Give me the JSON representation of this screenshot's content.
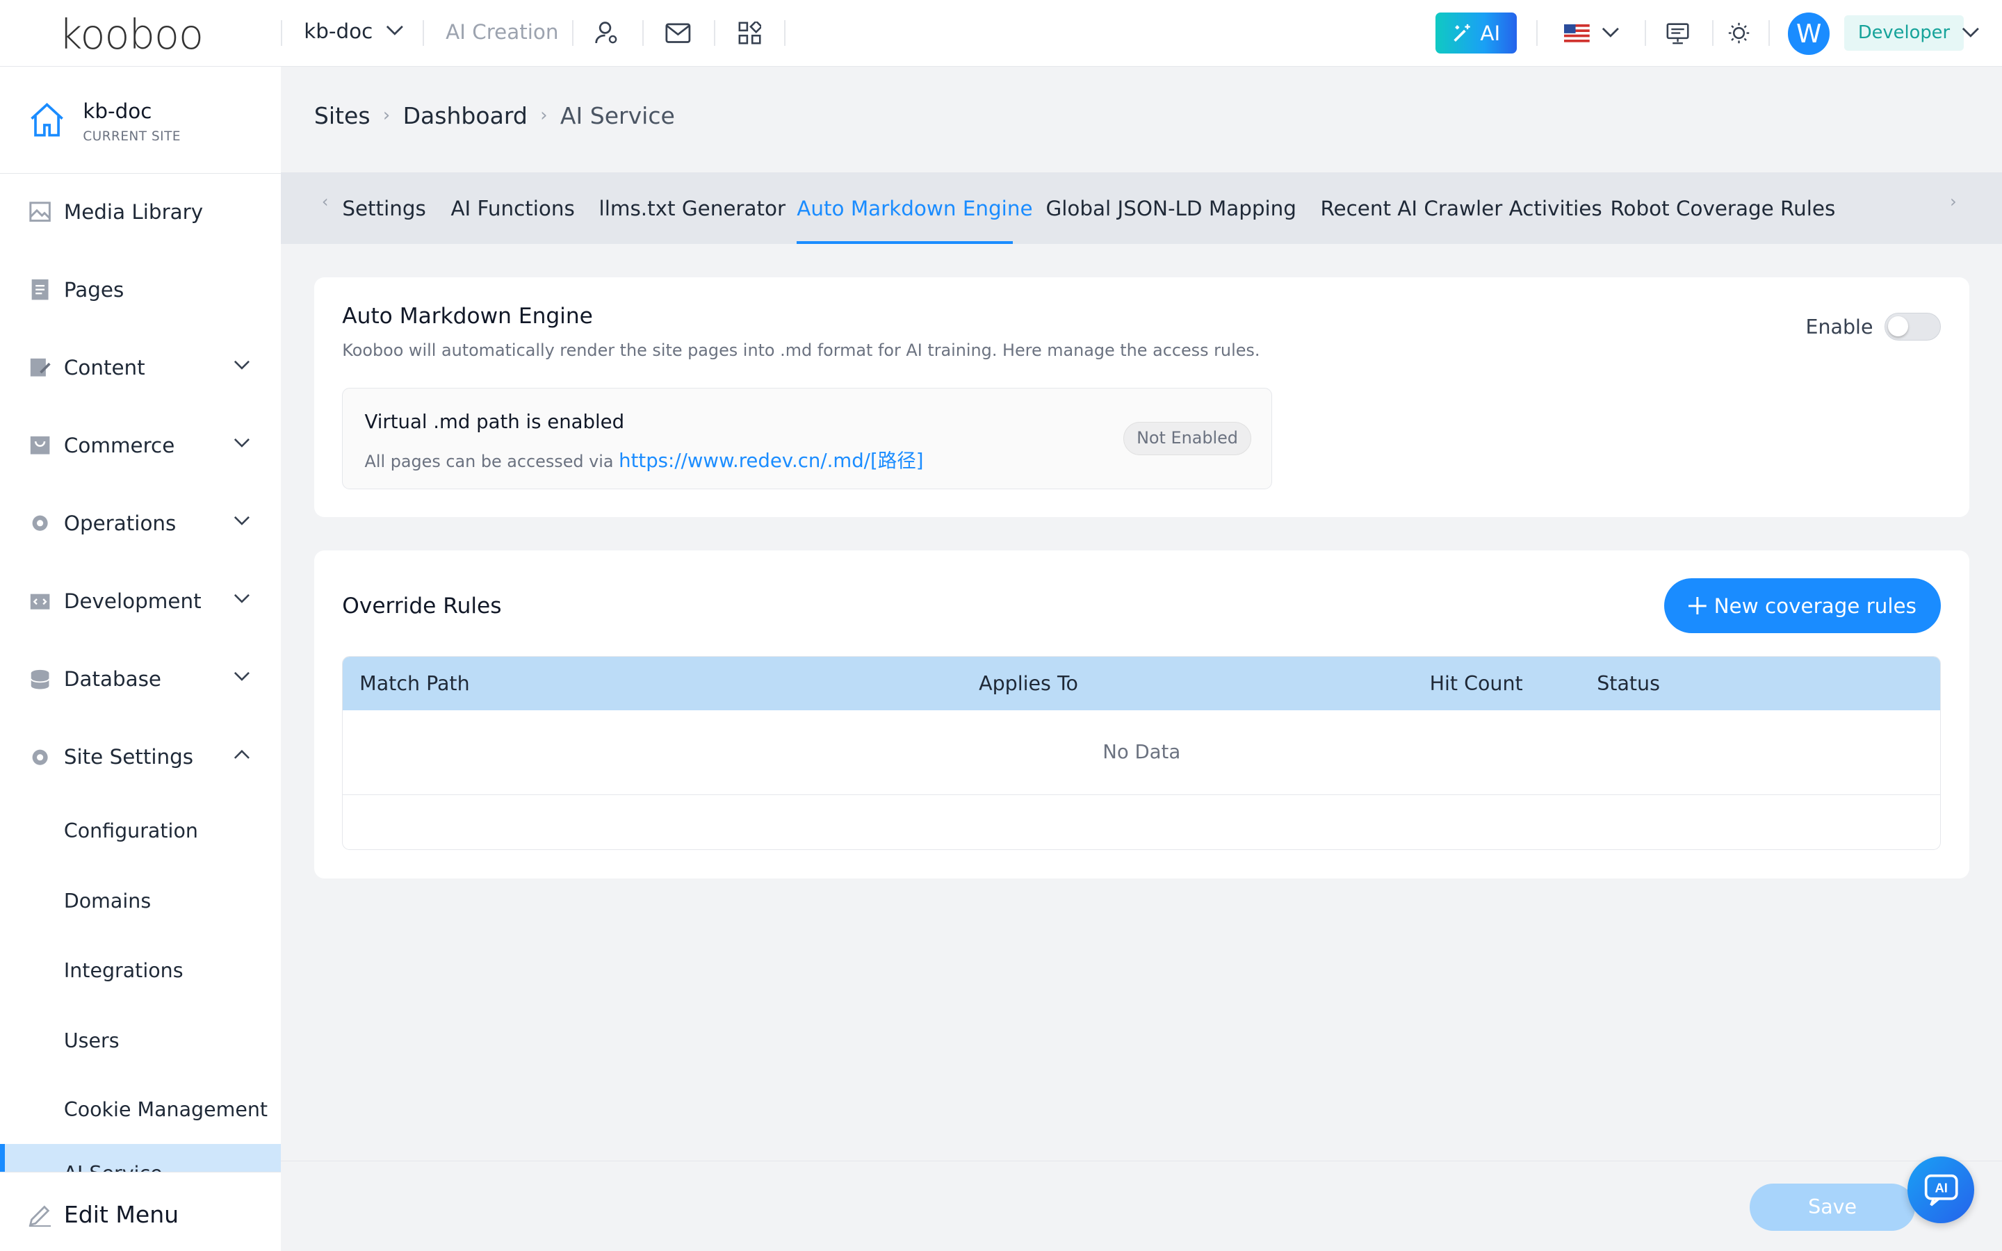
{
  "app": {
    "logo_text": "kooboo"
  },
  "topbar": {
    "site_name": "kb-doc",
    "ai_creation_label": "AI Creation",
    "ai_button_label": "AI",
    "avatar_initial": "W",
    "role_label": "Developer",
    "accent_color": "#1a8cff"
  },
  "sidebar": {
    "site_name": "kb-doc",
    "site_sub": "CURRENT SITE",
    "items": [
      {
        "label": "Media Library"
      },
      {
        "label": "Pages"
      },
      {
        "label": "Content"
      },
      {
        "label": "Commerce"
      },
      {
        "label": "Operations"
      },
      {
        "label": "Development"
      },
      {
        "label": "Database"
      },
      {
        "label": "Site Settings"
      }
    ],
    "sub_items": [
      {
        "label": "Configuration"
      },
      {
        "label": "Domains"
      },
      {
        "label": "Integrations"
      },
      {
        "label": "Users"
      },
      {
        "label": "Cookie Management"
      },
      {
        "label": "AI Service"
      }
    ],
    "edit_menu_label": "Edit Menu"
  },
  "breadcrumb": [
    "Sites",
    "Dashboard",
    "AI Service"
  ],
  "tabs": [
    {
      "label": "Settings"
    },
    {
      "label": "AI Functions"
    },
    {
      "label": "llms.txt Generator"
    },
    {
      "label": "Auto Markdown Engine"
    },
    {
      "label": "Global JSON-LD Mapping"
    },
    {
      "label": "Recent AI Crawler Activities"
    },
    {
      "label": "Robot Coverage Rules"
    }
  ],
  "engine": {
    "title": "Auto Markdown Engine",
    "description": "Kooboo will automatically render the site pages into .md format for AI training. Here manage the access rules.",
    "enable_label": "Enable",
    "virtual_title": "Virtual .md path is enabled",
    "virtual_desc": "All pages can be accessed via ",
    "virtual_link": "https://www.redev.cn/.md/[路径]",
    "status_pill": "Not Enabled"
  },
  "rules": {
    "title": "Override Rules",
    "new_button": "New coverage rules",
    "columns": [
      "Match Path",
      "Applies To",
      "Hit Count",
      "Status"
    ],
    "empty_text": "No Data"
  },
  "footer": {
    "save_label": "Save",
    "fab_label": "AI"
  }
}
